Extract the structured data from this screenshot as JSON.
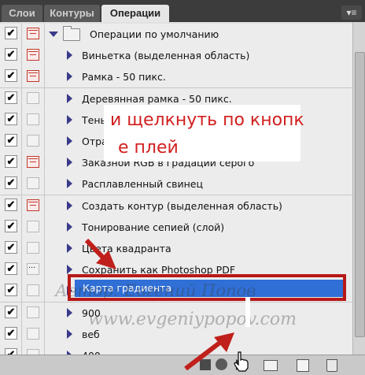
{
  "tabs": [
    {
      "label": "Слои",
      "active": false
    },
    {
      "label": "Контуры",
      "active": false
    },
    {
      "label": "Операции",
      "active": true
    }
  ],
  "panel_menu_icon": "panel-menu-icon",
  "actions": {
    "group": {
      "label": "Операции по умолчанию",
      "expanded": true
    },
    "items": [
      {
        "label": "Виньетка (выделенная область)",
        "dialog": "red"
      },
      {
        "label": "Рамка - 50 пикс.",
        "dialog": "red"
      },
      {
        "label": "Деревянная рамка - 50 пикс.",
        "dialog": "none"
      },
      {
        "label": "Тень",
        "dialog": "none"
      },
      {
        "label": "Отра",
        "dialog": "none"
      },
      {
        "label": "Заказной RGB в градации серого",
        "dialog": "red"
      },
      {
        "label": "Расплавленный свинец",
        "dialog": "none"
      },
      {
        "label": "Создать контур (выделенная область)",
        "dialog": "red"
      },
      {
        "label": "Тонирование сепией (слой)",
        "dialog": "none"
      },
      {
        "label": "Цвета квадранта",
        "dialog": "none"
      },
      {
        "label": "Сохранить как Photoshop PDF",
        "dialog": "dots"
      },
      {
        "label": "Карта градиента",
        "dialog": "none",
        "selected": true
      },
      {
        "label": "900",
        "dialog": "none"
      },
      {
        "label": "веб",
        "dialog": "none"
      },
      {
        "label": "400",
        "dialog": "none"
      }
    ]
  },
  "overlay": {
    "caption_line1": "и щелкнуть по кнопк",
    "caption_line2": "е плей",
    "watermark_author": "Автор: Евгений Попов",
    "watermark_site": "www.evgeniypopov.com",
    "accent_color": "#b81818"
  },
  "toolbar": {
    "buttons": [
      "stop-icon",
      "record-icon",
      "play-icon",
      "new-set-icon",
      "new-action-icon",
      "trash-icon"
    ]
  }
}
